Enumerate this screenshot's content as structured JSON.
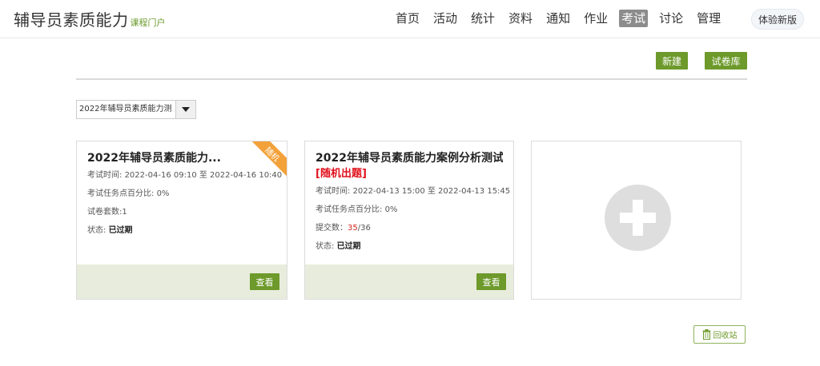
{
  "header": {
    "title": "辅导员素质能力",
    "subtitle": "课程门户",
    "nav": [
      "首页",
      "活动",
      "统计",
      "资料",
      "通知",
      "作业",
      "考试",
      "讨论",
      "管理"
    ],
    "active_nav": "考试",
    "try_new": "体验新版"
  },
  "toolbar": {
    "new_label": "新建",
    "library_label": "试卷库"
  },
  "filter": {
    "selected": "2022年辅导员素质能力测"
  },
  "exams": [
    {
      "title": "2022年辅导员素质能力...",
      "tag": "",
      "ribbon": "随机",
      "time_label": "考试时间:",
      "time_value": "2022-04-16 09:10 至 2022-04-16 10:40",
      "percent_label": "考试任务点百分比:",
      "percent_value": "0%",
      "sets_label": "试卷套数:",
      "sets_value": "1",
      "status_label": "状态:",
      "status_value": "已过期",
      "view_label": "查看"
    },
    {
      "title": "2022年辅导员素质能力案例分析测试",
      "tag": "[随机出题]",
      "time_label": "考试时间:",
      "time_value": "2022-04-13 15:00 至 2022-04-13 15:45",
      "percent_label": "考试任务点百分比:",
      "percent_value": "0%",
      "submit_label": "提交数：",
      "submit_done": "35",
      "submit_total": "/36",
      "status_label": "状态:",
      "status_value": "已过期",
      "view_label": "查看"
    }
  ],
  "recycle_label": "回收站",
  "colors": {
    "brand_green": "#6d9a2b",
    "card_footer": "#e8ecdc",
    "ribbon_orange": "#f3a13a",
    "tag_red": "#e0101b"
  }
}
